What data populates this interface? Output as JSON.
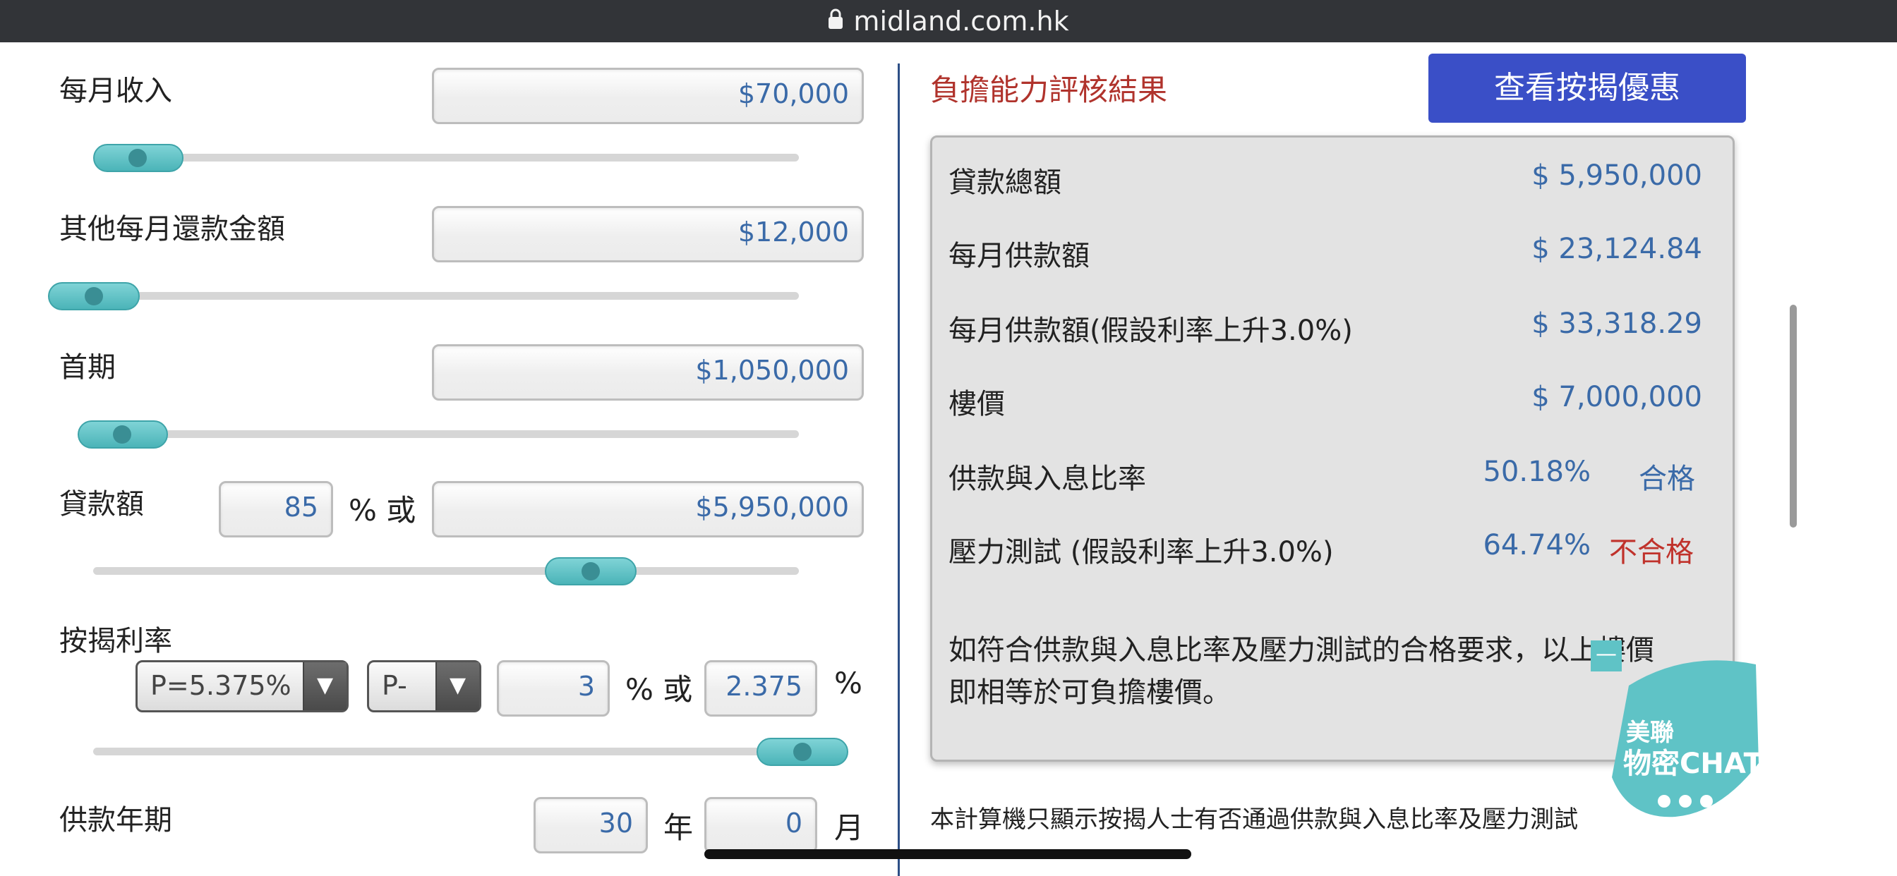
{
  "browser": {
    "url": "midland.com.hk"
  },
  "form": {
    "monthly_income": {
      "label": "每月收入",
      "value": "$70,000"
    },
    "other_repayment": {
      "label": "其他每月還款金額",
      "value": "$12,000"
    },
    "down_payment": {
      "label": "首期",
      "value": "$1,050,000"
    },
    "loan": {
      "label": "貸款額",
      "percent": "85",
      "or_text": "% 或",
      "value": "$5,950,000"
    },
    "rate": {
      "label": "按揭利率",
      "prime_select": "P=5.375%",
      "mode_select": "P-",
      "spread": "3",
      "or_text": "% 或",
      "value": "2.375",
      "unit": "%"
    },
    "tenor": {
      "label": "供款年期",
      "years": "30",
      "year_unit": "年",
      "months": "0",
      "month_unit": "月"
    },
    "slider_levels": {
      "monthly_income": 0.06,
      "other_repayment": 0.0,
      "down_payment": 0.04,
      "loan": 0.71,
      "rate": 1.0
    }
  },
  "result": {
    "title": "負擔能力評核結果",
    "offer_button": "查看按揭優惠",
    "rows": [
      {
        "label": "貸款總額",
        "value": "$ 5,950,000"
      },
      {
        "label": "每月供款額",
        "value": "$ 23,124.84"
      },
      {
        "label": "每月供款額(假設利率上升3.0%)",
        "value": "$ 33,318.29"
      },
      {
        "label": "樓價",
        "value": "$ 7,000,000"
      }
    ],
    "dsr": {
      "label": "供款與入息比率",
      "value": "50.18%",
      "status": "合格"
    },
    "stress": {
      "label": "壓力測試 (假設利率上升3.0%)",
      "value": "64.74%",
      "status": "不合格"
    },
    "note_line1": "如符合供款與入息比率及壓力測試的合格要求，以上樓價",
    "note_line2": "即相等於可負擔樓價。",
    "disclaimer": "本計算機只顯示按揭人士有否通過供款與入息比率及壓力測試"
  },
  "chat_widget": {
    "line1": "美聯",
    "line2": "物密CHAT",
    "minimize": "—"
  },
  "colors": {
    "accent_teal": "#5fc3c6",
    "button_blue": "#3a4fc7",
    "value_blue": "#3a6aa8",
    "fail_red": "#c0322b"
  }
}
